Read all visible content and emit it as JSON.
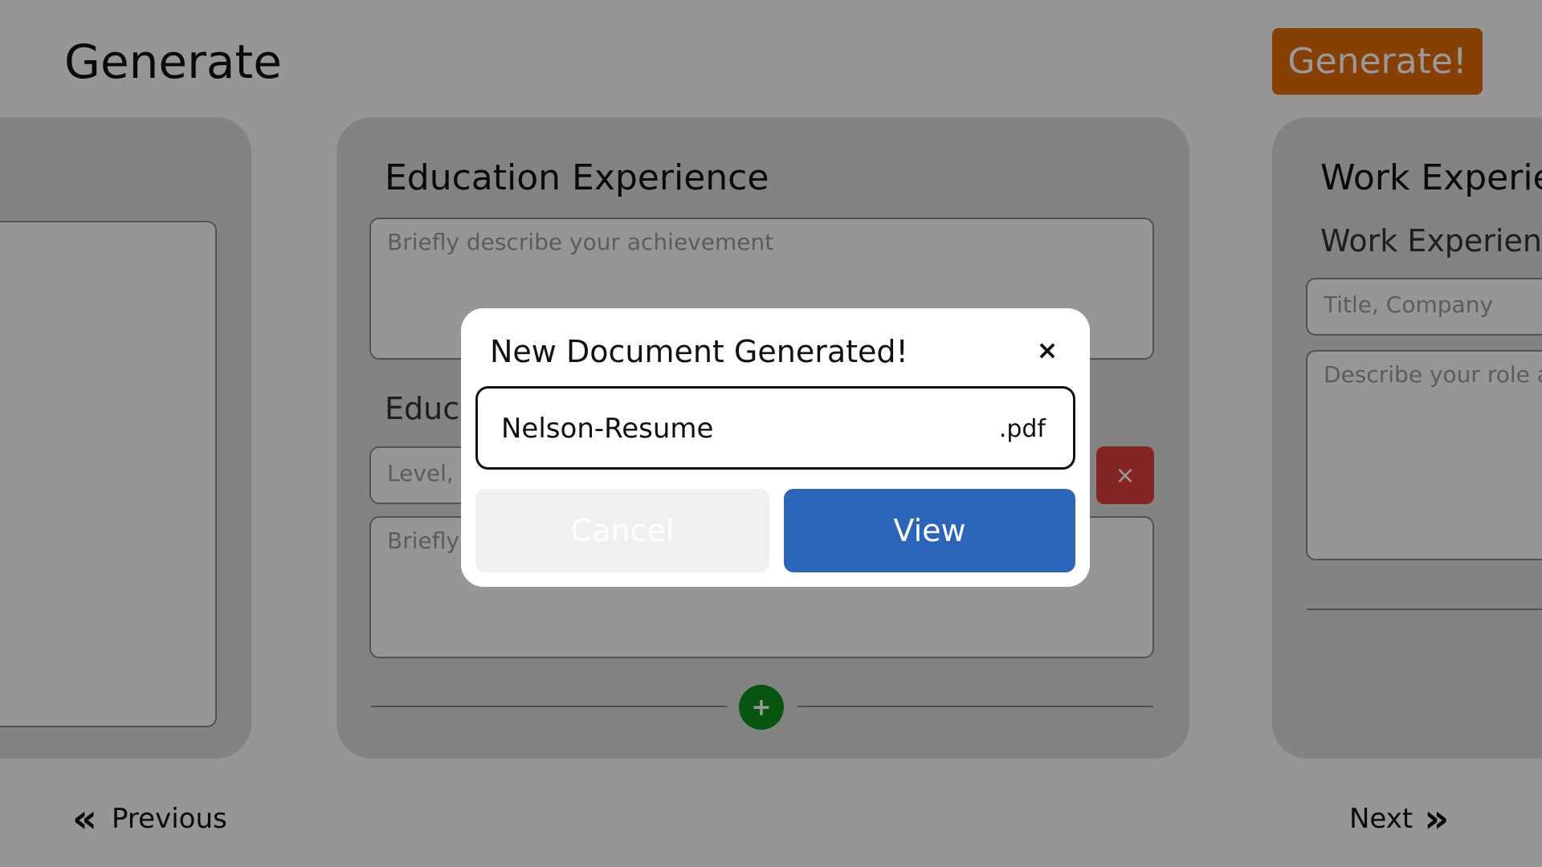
{
  "header": {
    "title": "Generate",
    "generate_label": "Generate!"
  },
  "cards": {
    "education": {
      "title": "Education Experience",
      "achievement_placeholder": "Briefly describe your achievement",
      "entry_title": "Educa",
      "level_placeholder": "Level, S",
      "entry_description_placeholder": "Briefly",
      "remove_icon": "×",
      "add_icon": "+"
    },
    "work": {
      "title": "Work Experien",
      "subtitle": "Work Experienc",
      "title_placeholder": "Title, Company",
      "role_placeholder": "Describe your role ar"
    }
  },
  "nav": {
    "previous_label": "Previous",
    "next_label": "Next",
    "previous_icon": "«",
    "next_icon": "»"
  },
  "modal": {
    "title": "New Document Generated!",
    "close_icon": "×",
    "filename_value": "Nelson-Resume",
    "filename_ext": ".pdf",
    "cancel_label": "Cancel",
    "view_label": "View"
  },
  "colors": {
    "accent_orange": "#e06b06",
    "view_blue": "#2a65ba",
    "remove_red": "#dc3c3c",
    "add_green": "#0b8f1f"
  }
}
